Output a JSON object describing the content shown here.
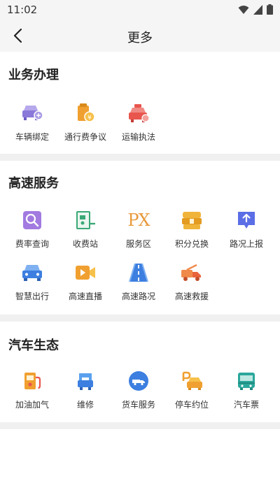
{
  "status": {
    "time": "11:02"
  },
  "nav": {
    "title": "更多"
  },
  "sections": [
    {
      "title": "业务办理",
      "items": [
        {
          "label": "车辆绑定",
          "icon": "car-bind-icon"
        },
        {
          "label": "通行费争议",
          "icon": "toll-dispute-icon"
        },
        {
          "label": "运输执法",
          "icon": "transport-enforcement-icon"
        }
      ]
    },
    {
      "title": "高速服务",
      "items": [
        {
          "label": "费率查询",
          "icon": "rate-query-icon"
        },
        {
          "label": "收费站",
          "icon": "toll-station-icon"
        },
        {
          "label": "服务区",
          "icon": "service-area-icon",
          "glyph": "PX"
        },
        {
          "label": "积分兑换",
          "icon": "points-exchange-icon"
        },
        {
          "label": "路况上报",
          "icon": "road-report-icon"
        },
        {
          "label": "智慧出行",
          "icon": "smart-travel-icon"
        },
        {
          "label": "高速直播",
          "icon": "highway-live-icon"
        },
        {
          "label": "高速路况",
          "icon": "highway-road-icon"
        },
        {
          "label": "高速救援",
          "icon": "highway-rescue-icon"
        }
      ]
    },
    {
      "title": "汽车生态",
      "items": [
        {
          "label": "加油加气",
          "icon": "fuel-icon"
        },
        {
          "label": "维修",
          "icon": "repair-icon"
        },
        {
          "label": "货车服务",
          "icon": "truck-service-icon"
        },
        {
          "label": "停车约位",
          "icon": "parking-icon"
        },
        {
          "label": "汽车票",
          "icon": "bus-ticket-icon"
        }
      ]
    }
  ],
  "colors": {
    "purple": "#8b79d9",
    "orange": "#f0a030",
    "red": "#e8564e",
    "green": "#3aa876",
    "blue": "#3d7fe0",
    "teal": "#2aa79b",
    "divider": "#f0f0f0"
  }
}
